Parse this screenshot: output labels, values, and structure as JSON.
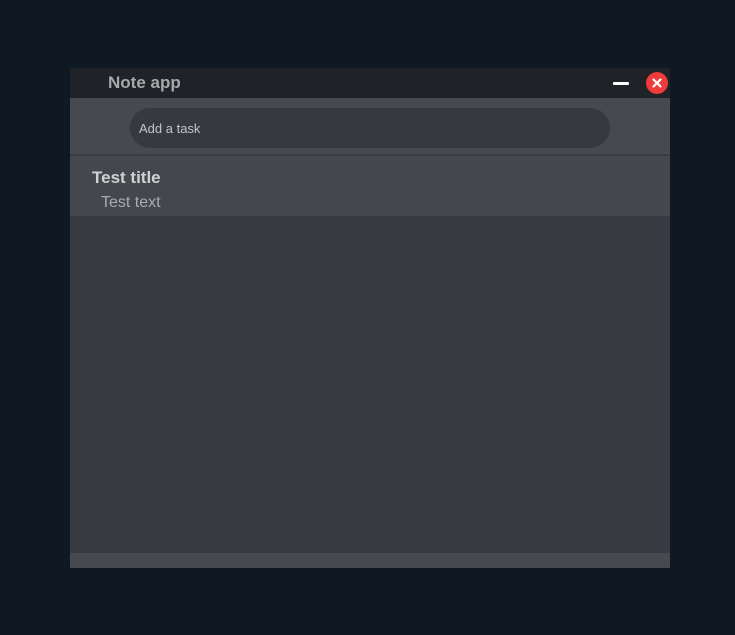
{
  "window": {
    "title": "Note app"
  },
  "titlebar": {
    "minimize_icon": "minimize-icon",
    "close_icon": "close-icon",
    "close_color": "#ef3b3b"
  },
  "task_input": {
    "placeholder": "Add a task",
    "value": ""
  },
  "notes": [
    {
      "title": "Test title",
      "text": "Test text"
    }
  ]
}
